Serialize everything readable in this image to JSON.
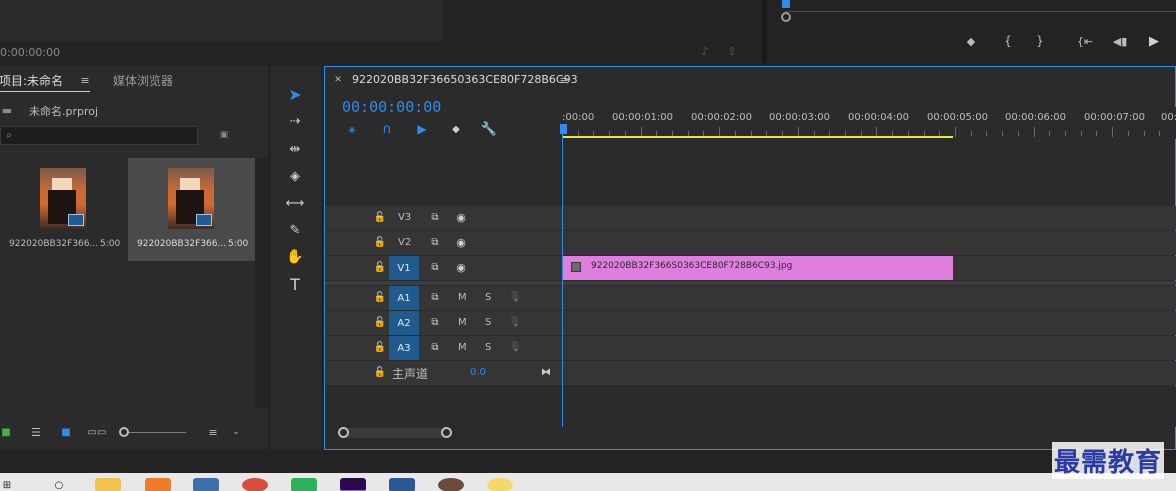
{
  "top_left_panel": {
    "timecode": "0:00:00:00"
  },
  "project_panel": {
    "tab_project": "项目:未命名",
    "tab_media_browser": "媒体浏览器",
    "file_name": "未命名.prproj",
    "search_placeholder": "",
    "items": [
      {
        "name": "922020BB32F366...",
        "duration": "5:00"
      },
      {
        "name": "922020BB32F366...",
        "duration": "5:00"
      }
    ]
  },
  "timeline": {
    "tab_title": "922020BB32F36650363CE80F728B6C93",
    "timecode": "00:00:00:00",
    "ruler_labels": [
      ":00:00",
      "00:00:01:00",
      "00:00:02:00",
      "00:00:03:00",
      "00:00:04:00",
      "00:00:05:00",
      "00:00:06:00",
      "00:00:07:00",
      "00:0"
    ],
    "video_tracks": [
      "V3",
      "V2",
      "V1"
    ],
    "audio_tracks": [
      "A1",
      "A2",
      "A3"
    ],
    "audio_controls": {
      "mute": "M",
      "solo": "S"
    },
    "master_label": "主声道",
    "master_value": "0.0",
    "clip_name": "922020BB32F366S0363CE80F728B6C93.jpg"
  },
  "watermark": "最需教育",
  "colors": {
    "accent_blue": "#2d8ceb",
    "clip_pink": "#e07ee0",
    "track_blue": "#1f5b8f",
    "in_out_yellow": "#e8e83a"
  },
  "icons": {
    "tools": [
      "selection-arrow-icon",
      "track-select-icon",
      "ripple-edit-icon",
      "razor-icon",
      "slip-icon",
      "pen-icon",
      "hand-icon",
      "type-icon"
    ],
    "program_controls": [
      "marker-icon",
      "mark-in-icon",
      "mark-out-icon",
      "go-to-in-icon",
      "step-back-icon",
      "play-icon"
    ]
  }
}
